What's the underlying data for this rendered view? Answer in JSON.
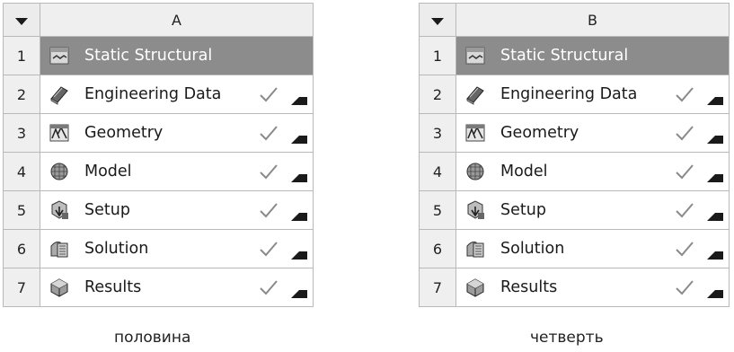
{
  "systems": [
    {
      "column_letter": "A",
      "title": "Static Structural",
      "caption": "половина",
      "rows": [
        {
          "num": "1",
          "label": "Static Structural"
        },
        {
          "num": "2",
          "label": "Engineering Data",
          "status": "up-to-date"
        },
        {
          "num": "3",
          "label": "Geometry",
          "status": "up-to-date"
        },
        {
          "num": "4",
          "label": "Model",
          "status": "up-to-date"
        },
        {
          "num": "5",
          "label": "Setup",
          "status": "up-to-date"
        },
        {
          "num": "6",
          "label": "Solution",
          "status": "up-to-date"
        },
        {
          "num": "7",
          "label": "Results",
          "status": "up-to-date"
        }
      ]
    },
    {
      "column_letter": "B",
      "title": "Static Structural",
      "caption": "четверть",
      "rows": [
        {
          "num": "1",
          "label": "Static Structural"
        },
        {
          "num": "2",
          "label": "Engineering Data",
          "status": "up-to-date"
        },
        {
          "num": "3",
          "label": "Geometry",
          "status": "up-to-date"
        },
        {
          "num": "4",
          "label": "Model",
          "status": "up-to-date"
        },
        {
          "num": "5",
          "label": "Setup",
          "status": "up-to-date"
        },
        {
          "num": "6",
          "label": "Solution",
          "status": "up-to-date"
        },
        {
          "num": "7",
          "label": "Results",
          "status": "up-to-date"
        }
      ]
    }
  ],
  "icons": {
    "row1": "static-structural-icon",
    "row2": "engineering-data-icon",
    "row3": "geometry-icon",
    "row4": "model-icon",
    "row5": "setup-icon",
    "row6": "solution-icon",
    "row7": "results-icon"
  },
  "colors": {
    "title_row_bg": "#8c8c8c",
    "header_bg": "#efefef",
    "grid_line": "#b9b9b9"
  }
}
